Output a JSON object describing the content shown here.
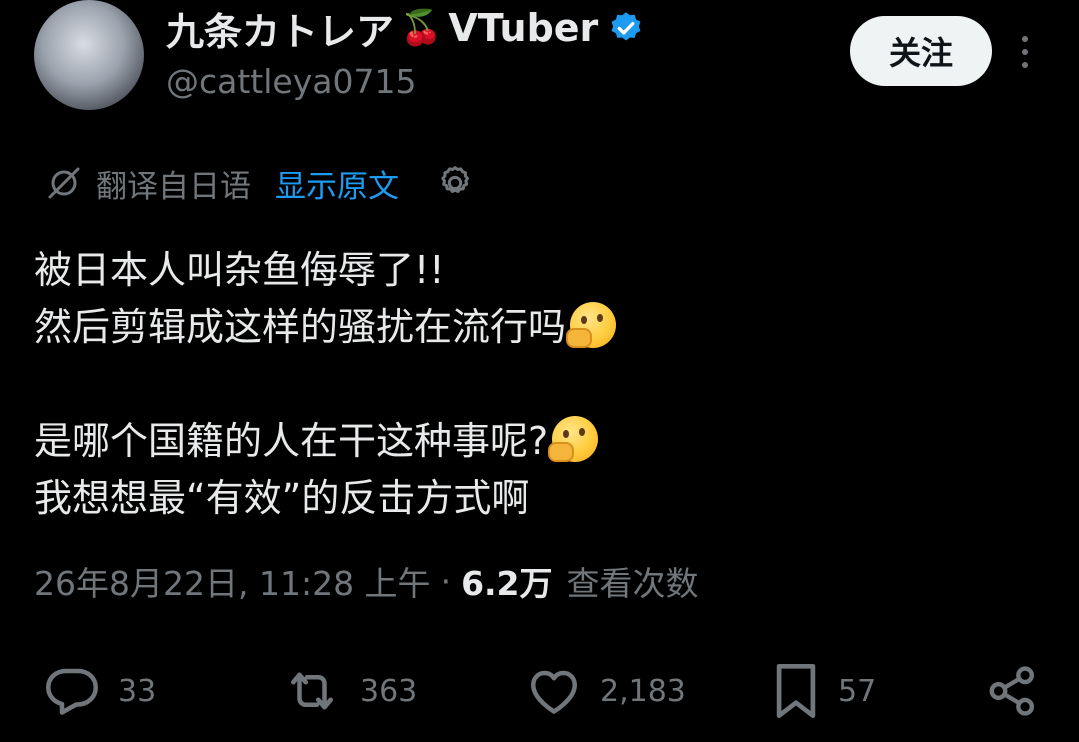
{
  "author": {
    "display_name": "九条カトレア",
    "emoji": "🍒",
    "name_suffix": "VTuber",
    "handle": "@cattleya0715"
  },
  "header": {
    "follow_label": "关注"
  },
  "translation": {
    "translated_from": "翻译自日语",
    "show_original": "显示原文"
  },
  "post": {
    "lines": [
      "被日本人叫杂鱼侮辱了!!",
      "然后剪辑成这样的骚扰在流行吗",
      "是哪个国籍的人在干这种事呢?",
      "我想想最“有效”的反击方式啊"
    ]
  },
  "meta": {
    "timestamp": "26年8月22日, 11:28 上午",
    "separator": "·",
    "views_count": "6.2万",
    "views_label": "查看次数"
  },
  "actions": {
    "replies": "33",
    "reposts": "363",
    "likes": "2,183",
    "bookmarks": "57"
  },
  "colors": {
    "background": "#000000",
    "text": "#e7e9ea",
    "secondary": "#71767b",
    "accent": "#1d9bf0"
  }
}
